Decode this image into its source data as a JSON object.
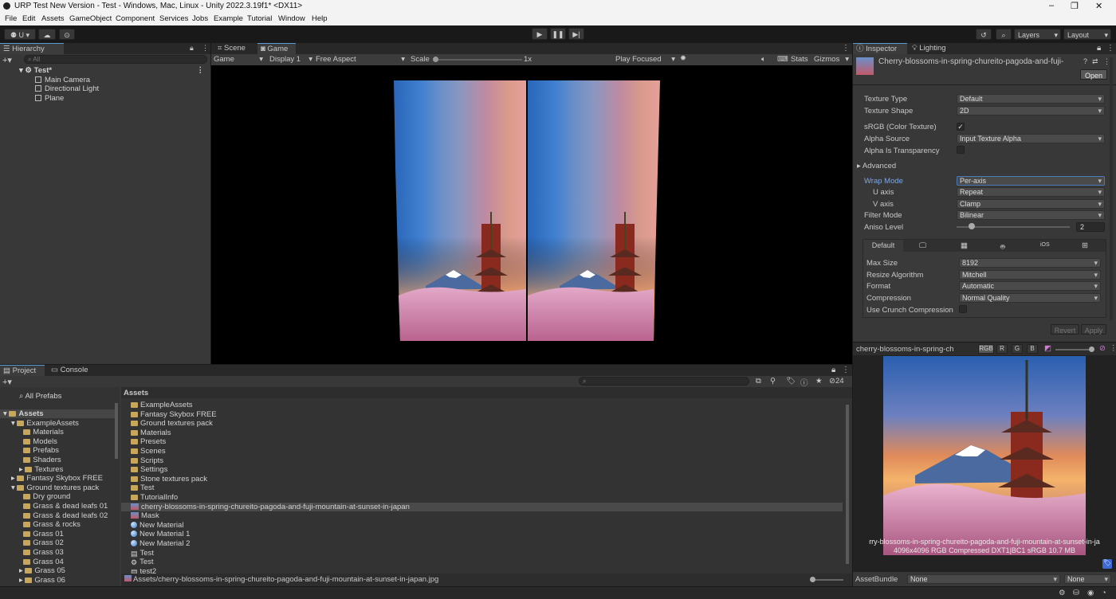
{
  "window": {
    "title": "URP Test New Version - Test - Windows, Mac, Linux - Unity 2022.3.19f1* <DX11>",
    "controls": [
      "–",
      "❐",
      "✕"
    ]
  },
  "menu": [
    "File",
    "Edit",
    "Assets",
    "GameObject",
    "Component",
    "Services",
    "Jobs",
    "Example",
    "Tutorial",
    "Window",
    "Help"
  ],
  "toolbar": {
    "account": "U",
    "layers": "Layers",
    "layout": "Layout"
  },
  "hierarchy": {
    "tab": "Hierarchy",
    "search_placeholder": "All",
    "scene": "Test*",
    "items": [
      "Main Camera",
      "Directional Light",
      "Plane"
    ]
  },
  "game_view": {
    "tabs": [
      "Scene",
      "Game"
    ],
    "display_mode": "Game",
    "display": "Display 1",
    "aspect": "Free Aspect",
    "scale_label": "Scale",
    "scale_value": "1x",
    "play_focused": "Play Focused",
    "stats": "Stats",
    "gizmos": "Gizmos"
  },
  "inspector": {
    "tabs": [
      "Inspector",
      "Lighting"
    ],
    "asset_name": "Cherry-blossoms-in-spring-chureito-pagoda-and-fuji-",
    "open_button": "Open",
    "fields": [
      {
        "label": "Texture Type",
        "value": "Default"
      },
      {
        "label": "Texture Shape",
        "value": "2D"
      }
    ],
    "srgb_label": "sRGB (Color Texture)",
    "srgb_checked": "✓",
    "alpha_source_label": "Alpha Source",
    "alpha_source_value": "Input Texture Alpha",
    "alpha_transparency_label": "Alpha Is Transparency",
    "advanced_label": "Advanced",
    "wrap_mode_label": "Wrap Mode",
    "wrap_mode_value": "Per-axis",
    "u_axis_label": "U axis",
    "u_axis_value": "Repeat",
    "v_axis_label": "V axis",
    "v_axis_value": "Clamp",
    "filter_mode_label": "Filter Mode",
    "filter_mode_value": "Bilinear",
    "aniso_label": "Aniso Level",
    "aniso_value": "2",
    "aniso_fraction": 0.133,
    "platform_tab_default": "Default",
    "platform_tab_ios": "iOS",
    "platform_fields": [
      {
        "label": "Max Size",
        "value": "8192"
      },
      {
        "label": "Resize Algorithm",
        "value": "Mitchell"
      },
      {
        "label": "Format",
        "value": "Automatic"
      },
      {
        "label": "Compression",
        "value": "Normal Quality"
      }
    ],
    "crunch_label": "Use Crunch Compression",
    "revert_button": "Revert",
    "apply_button": "Apply"
  },
  "preview": {
    "title": "cherry-blossoms-in-spring-ch",
    "channels": [
      "RGB",
      "R",
      "G",
      "B"
    ],
    "caption_name": "rry-blossoms-in-spring-chureito-pagoda-and-fuji-mountain-at-sunset-in-ja",
    "caption_info": "4096x4096 RGB Compressed DXT1|BC1 sRGB  10.7 MB"
  },
  "assetbundle": {
    "label": "AssetBundle",
    "value1": "None",
    "value2": "None"
  },
  "project": {
    "tabs": [
      "Project",
      "Console"
    ],
    "favorites": [
      "All Prefabs"
    ],
    "tree": [
      {
        "label": "Assets",
        "indent": 0,
        "bold": true
      },
      {
        "label": "ExampleAssets",
        "indent": 1
      },
      {
        "label": "Materials",
        "indent": 2
      },
      {
        "label": "Models",
        "indent": 2
      },
      {
        "label": "Prefabs",
        "indent": 2
      },
      {
        "label": "Shaders",
        "indent": 2
      },
      {
        "label": "Textures",
        "indent": 2
      },
      {
        "label": "Fantasy Skybox FREE",
        "indent": 1
      },
      {
        "label": "Ground textures pack",
        "indent": 1
      },
      {
        "label": "Dry ground",
        "indent": 2
      },
      {
        "label": "Grass & dead leafs 01",
        "indent": 2
      },
      {
        "label": "Grass & dead leafs 02",
        "indent": 2
      },
      {
        "label": "Grass & rocks",
        "indent": 2
      },
      {
        "label": "Grass 01",
        "indent": 2
      },
      {
        "label": "Grass 02",
        "indent": 2
      },
      {
        "label": "Grass 03",
        "indent": 2
      },
      {
        "label": "Grass 04",
        "indent": 2
      },
      {
        "label": "Grass 05",
        "indent": 2
      },
      {
        "label": "Grass 06",
        "indent": 2
      }
    ],
    "breadcrumb": "Assets",
    "hidden_count": "24",
    "files": [
      {
        "label": "ExampleAssets",
        "kind": "folder"
      },
      {
        "label": "Fantasy Skybox FREE",
        "kind": "folder"
      },
      {
        "label": "Ground textures pack",
        "kind": "folder"
      },
      {
        "label": "Materials",
        "kind": "folder"
      },
      {
        "label": "Presets",
        "kind": "folder"
      },
      {
        "label": "Scenes",
        "kind": "folder"
      },
      {
        "label": "Scripts",
        "kind": "folder"
      },
      {
        "label": "Settings",
        "kind": "folder"
      },
      {
        "label": "Stone textures pack",
        "kind": "folder"
      },
      {
        "label": "Test",
        "kind": "folder"
      },
      {
        "label": "TutorialInfo",
        "kind": "folder"
      },
      {
        "label": "cherry-blossoms-in-spring-chureito-pagoda-and-fuji-mountain-at-sunset-in-japan",
        "kind": "texture",
        "selected": true
      },
      {
        "label": "Mask",
        "kind": "texture"
      },
      {
        "label": "New Material",
        "kind": "material"
      },
      {
        "label": "New Material 1",
        "kind": "material"
      },
      {
        "label": "New Material 2",
        "kind": "material"
      },
      {
        "label": "Test",
        "kind": "scene"
      },
      {
        "label": "Test",
        "kind": "settings"
      },
      {
        "label": "test2",
        "kind": "scene"
      }
    ],
    "footer_path": "Assets/cherry-blossoms-in-spring-chureito-pagoda-and-fuji-mountain-at-sunset-in-japan.jpg"
  }
}
